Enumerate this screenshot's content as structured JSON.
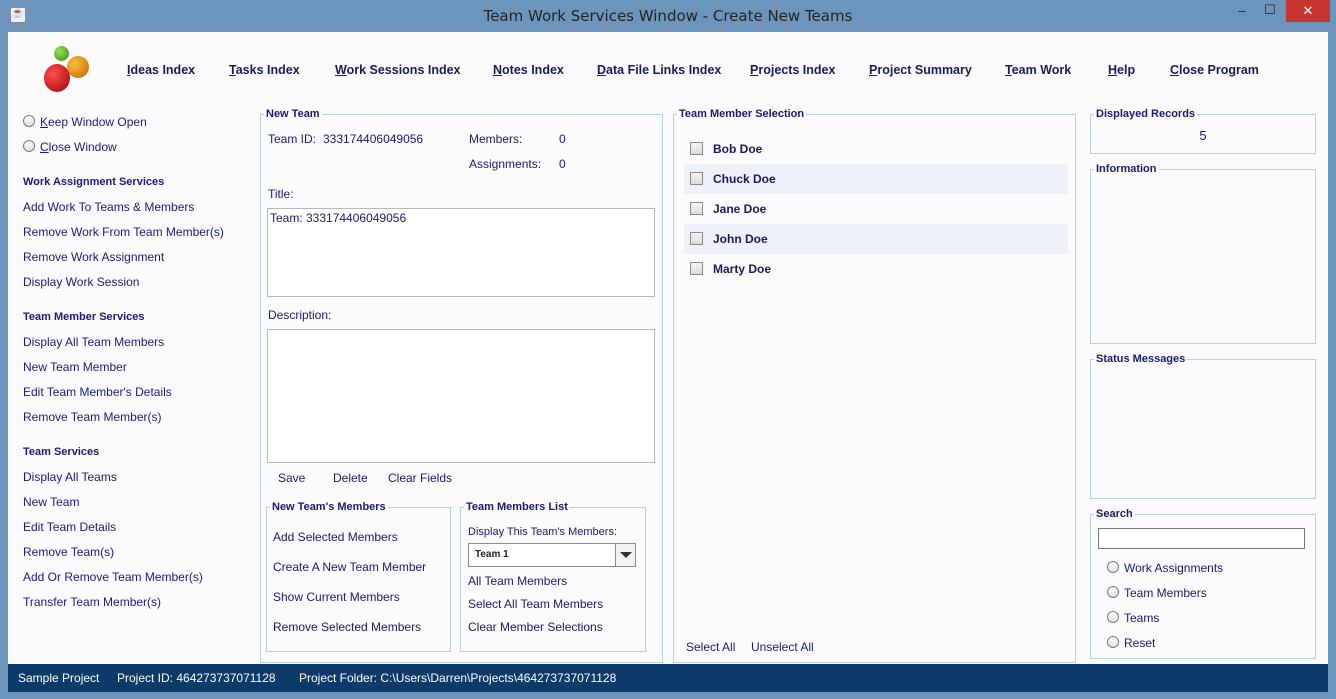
{
  "window": {
    "title": "Team Work Services Window - Create New Teams",
    "min": "–",
    "max": "☐",
    "close": "✕"
  },
  "nav": [
    "Ideas Index",
    "Tasks Index",
    "Work Sessions Index",
    "Notes Index",
    "Data File Links Index",
    "Projects Index",
    "Project Summary",
    "Team Work",
    "Help",
    "Close Program"
  ],
  "sidebar": {
    "options": [
      "Keep Window Open",
      "Close Window"
    ],
    "sections": [
      {
        "title": "Work Assignment Services",
        "items": [
          "Add Work To Teams & Members",
          "Remove Work From Team Member(s)",
          "Remove Work Assignment",
          "Display Work Session"
        ]
      },
      {
        "title": "Team Member Services",
        "items": [
          "Display All Team Members",
          "New Team Member",
          "Edit Team Member's Details",
          "Remove Team Member(s)"
        ]
      },
      {
        "title": "Team Services",
        "items": [
          "Display All Teams",
          "New Team",
          "Edit Team Details",
          "Remove Team(s)",
          "Add Or Remove Team Member(s)",
          "Transfer Team Member(s)"
        ]
      }
    ]
  },
  "new_team": {
    "legend": "New Team",
    "team_id_label": "Team ID:",
    "team_id": "333174406049056",
    "members_label": "Members:",
    "members": "0",
    "assignments_label": "Assignments:",
    "assignments": "0",
    "title_label": "Title:",
    "title_value": "Team: 333174406049056",
    "description_label": "Description:",
    "description_value": "",
    "save": "Save",
    "delete": "Delete",
    "clear": "Clear Fields"
  },
  "new_members": {
    "legend": "New Team's Members",
    "items": [
      "Add Selected Members",
      "Create A New Team Member",
      "Show Current Members",
      "Remove Selected Members"
    ]
  },
  "members_list": {
    "legend": "Team Members List",
    "display_label": "Display This Team's Members:",
    "selected": "Team 1",
    "items": [
      "All Team Members",
      "Select All Team Members",
      "Clear Member Selections"
    ]
  },
  "selection": {
    "legend": "Team Member Selection",
    "members": [
      "Bob Doe",
      "Chuck Doe",
      "Jane Doe",
      "John Doe",
      "Marty Doe"
    ],
    "select_all": "Select All",
    "unselect_all": "Unselect All"
  },
  "displayed": {
    "legend": "Displayed Records",
    "value": "5"
  },
  "information": {
    "legend": "Information"
  },
  "status_messages": {
    "legend": "Status Messages"
  },
  "search": {
    "legend": "Search",
    "value": "",
    "options": [
      "Work Assignments",
      "Team Members",
      "Teams",
      "Reset"
    ]
  },
  "statusbar": {
    "project": "Sample Project",
    "project_id": "Project ID:  464273737071128",
    "folder": "Project Folder: C:\\Users\\Darren\\Projects\\464273737071128"
  }
}
